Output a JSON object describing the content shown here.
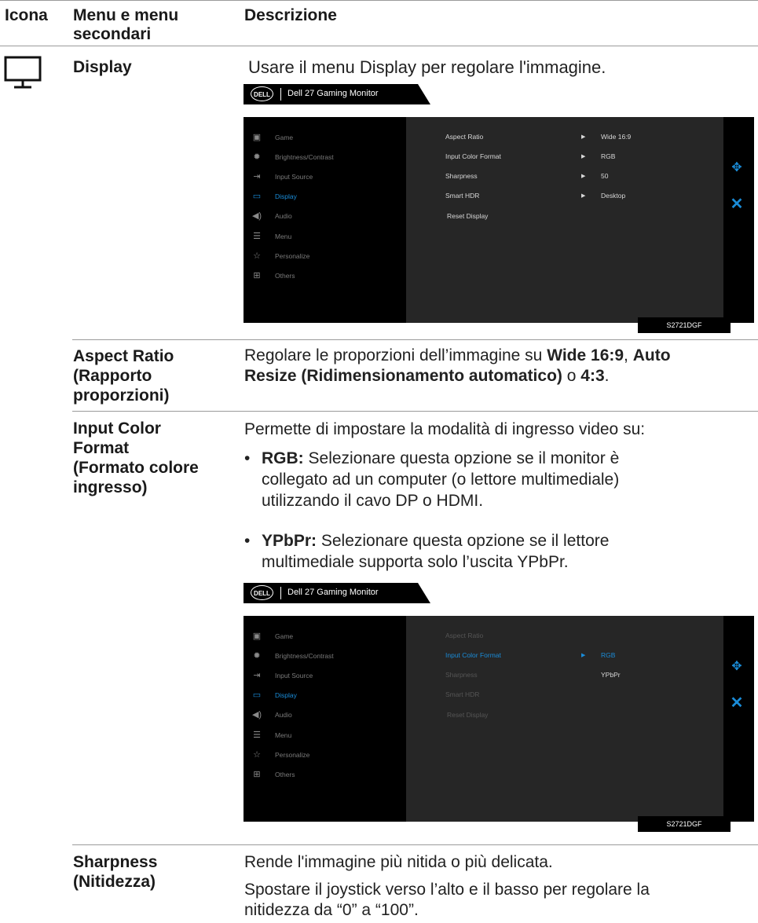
{
  "header": {
    "col_icon": "Icona",
    "col_menu_line1": "Menu e menu",
    "col_menu_line2": "secondari",
    "col_desc": "Descrizione"
  },
  "display": {
    "label": "Display",
    "desc": "Usare il menu Display per regolare l'immagine."
  },
  "osd_common": {
    "brand": "DELL",
    "title": "Dell 27 Gaming Monitor",
    "model": "S2721DGF",
    "menu": [
      {
        "icon": "game-icon",
        "label": "Game"
      },
      {
        "icon": "brightness-icon",
        "label": "Brightness/Contrast"
      },
      {
        "icon": "input-source-icon",
        "label": "Input Source"
      },
      {
        "icon": "display-icon",
        "label": "Display"
      },
      {
        "icon": "audio-icon",
        "label": "Audio"
      },
      {
        "icon": "menu-icon",
        "label": "Menu"
      },
      {
        "icon": "star-icon",
        "label": "Personalize"
      },
      {
        "icon": "others-icon",
        "label": "Others"
      }
    ],
    "accent": "#1a8cd8"
  },
  "osd1": {
    "rows": [
      {
        "label": "Aspect Ratio",
        "value": "Wide 16:9"
      },
      {
        "label": "Input Color Format",
        "value": "RGB"
      },
      {
        "label": "Sharpness",
        "value": "50"
      },
      {
        "label": "Smart HDR",
        "value": "Desktop"
      },
      {
        "label": "Reset Display",
        "value": ""
      }
    ]
  },
  "osd2": {
    "rows": [
      "Aspect Ratio",
      "Input Color Format",
      "Sharpness",
      "Smart HDR",
      "Reset Display"
    ],
    "options": [
      "RGB",
      "YPbPr"
    ]
  },
  "aspect": {
    "label1": "Aspect Ratio",
    "label2": "(Rapporto",
    "label3": "proporzioni)",
    "t1": "Regolare le proporzioni dell’immagine su ",
    "b1": "Wide 16:9",
    "t2": ", ",
    "b2": "Auto",
    "b3": "Resize (Ridimensionamento automatico)",
    "t3": " o ",
    "b4": "4:3",
    "t4": "."
  },
  "icf": {
    "label1": "Input Color",
    "label2": "Format",
    "label3": "(Formato colore",
    "label4": "ingresso)",
    "intro": "Permette di impostare la modalità di ingresso video su:",
    "rgb_term": "RGB:",
    "rgb_l1": " Selezionare questa opzione se il monitor è",
    "rgb_l2": "collegato ad un computer (o lettore multimediale)",
    "rgb_l3": "utilizzando il cavo DP o HDMI.",
    "ypbpr_term": "YPbPr:",
    "ypbpr_l1": " Selezionare questa opzione se il lettore",
    "ypbpr_l2": "multimediale supporta solo l’uscita YPbPr."
  },
  "sharp": {
    "label1": "Sharpness",
    "label2": "(Nitidezza)",
    "d1": "Rende l'immagine più nitida o più delicata.",
    "d2": "Spostare il joystick verso l’alto e il basso per regolare la",
    "d3": "nitidezza da “0” a “100”."
  }
}
